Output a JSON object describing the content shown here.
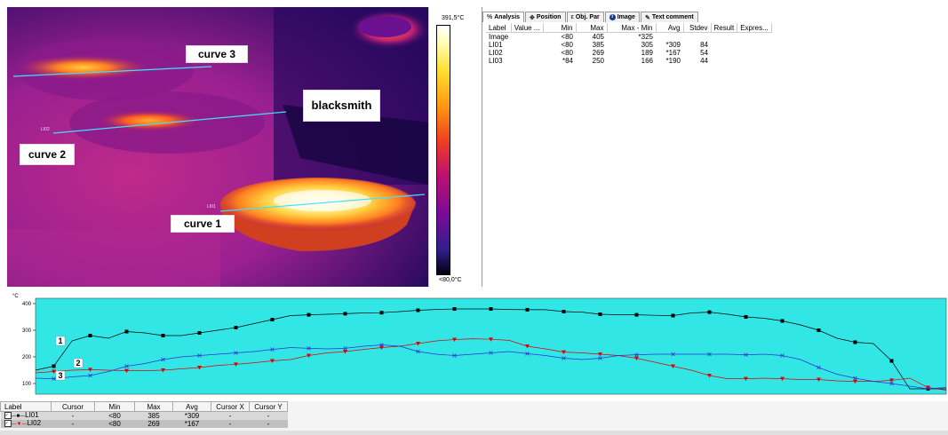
{
  "thermal": {
    "scale_max": "391,5°C",
    "scale_min": "<80,0°C",
    "annotations": {
      "curve1": "curve 1",
      "curve2": "curve 2",
      "curve3": "curve 3",
      "blacksmith": "blacksmith"
    },
    "line_ids": {
      "li01": "LI01",
      "li02": "LI02"
    },
    "colors": {
      "line": "#40e0ff",
      "background": "#3a0a78"
    }
  },
  "analysis": {
    "tabs": [
      {
        "label": "Analysis",
        "icon": "analysis-icon"
      },
      {
        "label": "Position",
        "icon": "position-icon"
      },
      {
        "label": "Obj. Par",
        "icon": "objpar-icon"
      },
      {
        "label": "Image",
        "icon": "info-icon"
      },
      {
        "label": "Text comment",
        "icon": "text-icon"
      }
    ],
    "columns": [
      "Label",
      "Value ...",
      "Min",
      "Max",
      "Max - Min",
      "Avg",
      "Stdev",
      "Result",
      "Expres..."
    ],
    "rows": [
      [
        "Image",
        "",
        "<80",
        "405",
        "*325",
        "",
        "",
        "",
        ""
      ],
      [
        "LI01",
        "",
        "<80",
        "385",
        "305",
        "*309",
        "84",
        "",
        ""
      ],
      [
        "LI02",
        "",
        "<80",
        "269",
        "189",
        "*167",
        "54",
        "",
        ""
      ],
      [
        "LI03",
        "",
        "*84",
        "250",
        "166",
        "*190",
        "44",
        "",
        ""
      ]
    ]
  },
  "chart_data": {
    "type": "line",
    "ylabel": "°C",
    "yticks": [
      100,
      200,
      300,
      400
    ],
    "ylim": [
      60,
      420
    ],
    "xlim": [
      0,
      100
    ],
    "background": "#33e6e6",
    "curve_labels": [
      "1",
      "2",
      "3"
    ],
    "series": [
      {
        "name": "LI01",
        "color": "#000000",
        "marker": "square",
        "x": [
          0,
          2,
          4,
          6,
          8,
          10,
          12,
          14,
          16,
          18,
          20,
          22,
          24,
          26,
          28,
          30,
          32,
          34,
          36,
          38,
          40,
          42,
          44,
          46,
          48,
          50,
          52,
          54,
          56,
          58,
          60,
          62,
          64,
          66,
          68,
          70,
          72,
          74,
          76,
          78,
          80,
          82,
          84,
          86,
          88,
          90,
          92,
          94,
          96,
          98,
          100
        ],
        "y": [
          150,
          165,
          260,
          280,
          270,
          295,
          290,
          280,
          280,
          290,
          300,
          310,
          325,
          340,
          355,
          358,
          360,
          362,
          365,
          366,
          370,
          375,
          378,
          380,
          380,
          380,
          378,
          377,
          377,
          370,
          368,
          360,
          358,
          358,
          356,
          355,
          365,
          368,
          360,
          350,
          345,
          335,
          320,
          300,
          270,
          255,
          250,
          185,
          80,
          80,
          80
        ]
      },
      {
        "name": "LI02",
        "color": "#e00000",
        "marker": "triangle",
        "x": [
          0,
          2,
          4,
          6,
          8,
          10,
          12,
          14,
          16,
          18,
          20,
          22,
          24,
          26,
          28,
          30,
          32,
          34,
          36,
          38,
          40,
          42,
          44,
          46,
          48,
          50,
          52,
          54,
          56,
          58,
          60,
          62,
          64,
          66,
          68,
          70,
          72,
          74,
          76,
          78,
          80,
          82,
          84,
          86,
          88,
          90,
          92,
          94,
          96,
          98,
          100
        ],
        "y": [
          140,
          145,
          150,
          152,
          150,
          148,
          148,
          150,
          155,
          160,
          168,
          172,
          178,
          185,
          190,
          205,
          215,
          220,
          228,
          235,
          240,
          250,
          260,
          265,
          268,
          266,
          262,
          240,
          230,
          218,
          215,
          210,
          205,
          195,
          180,
          165,
          150,
          130,
          118,
          118,
          120,
          118,
          115,
          115,
          110,
          108,
          108,
          112,
          120,
          85,
          75
        ]
      },
      {
        "name": "LI03",
        "color": "#3030d0",
        "marker": "x",
        "x": [
          0,
          2,
          4,
          6,
          8,
          10,
          12,
          14,
          16,
          18,
          20,
          22,
          24,
          26,
          28,
          30,
          32,
          34,
          36,
          38,
          40,
          42,
          44,
          46,
          48,
          50,
          52,
          54,
          56,
          58,
          60,
          62,
          64,
          66,
          68,
          70,
          72,
          74,
          76,
          78,
          80,
          82,
          84,
          86,
          88,
          90,
          92,
          94,
          96,
          98,
          100
        ],
        "y": [
          120,
          118,
          125,
          130,
          145,
          165,
          175,
          190,
          200,
          205,
          210,
          215,
          220,
          228,
          235,
          232,
          230,
          232,
          240,
          245,
          240,
          220,
          210,
          205,
          210,
          215,
          220,
          212,
          205,
          195,
          190,
          195,
          205,
          208,
          210,
          210,
          210,
          210,
          210,
          208,
          210,
          205,
          190,
          160,
          135,
          120,
          108,
          100,
          90,
          80,
          85
        ]
      }
    ]
  },
  "legend": {
    "columns": [
      "Label",
      "Cursor",
      "Min",
      "Max",
      "Avg",
      "Cursor X",
      "Cursor Y"
    ],
    "rows": [
      [
        "LI01",
        "-",
        "<80",
        "385",
        "*309",
        "-",
        "-"
      ],
      [
        "LI02",
        "-",
        "<80",
        "269",
        "*167",
        "-",
        "-"
      ]
    ]
  }
}
